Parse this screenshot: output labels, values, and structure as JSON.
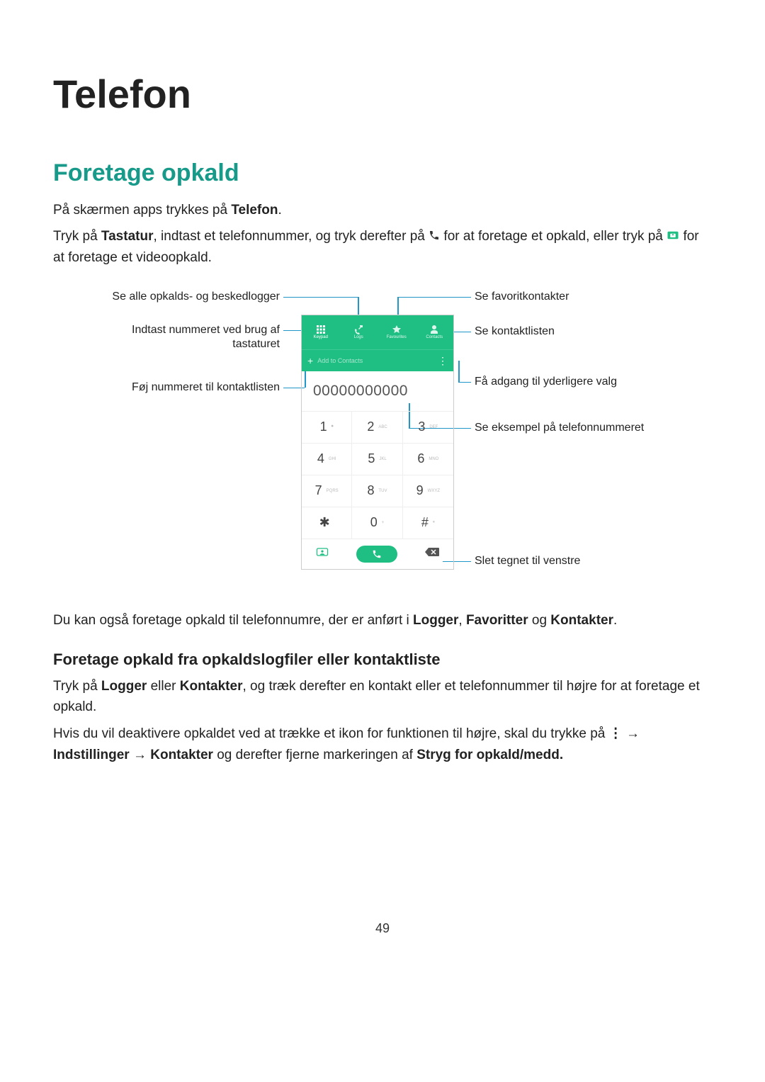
{
  "page_number": "49",
  "title": "Telefon",
  "section_h2": "Foretage opkald",
  "p1_a": "På skærmen apps trykkes på ",
  "p1_b": "Telefon",
  "p1_c": ".",
  "p2_a": "Tryk på ",
  "p2_b": "Tastatur",
  "p2_c": ", indtast et telefonnummer, og tryk derefter på ",
  "p2_d": " for at foretage et opkald, eller tryk på ",
  "p2_e": " for at foretage et videoopkald.",
  "p3_a": "Du kan også foretage opkald til telefonnumre, der er anført i ",
  "p3_b": "Logger",
  "p3_c": ", ",
  "p3_d": "Favoritter",
  "p3_e": " og ",
  "p3_f": "Kontakter",
  "p3_g": ".",
  "h3": "Foretage opkald fra opkaldslogfiler eller kontaktliste",
  "p4_a": "Tryk på ",
  "p4_b": "Logger",
  "p4_c": " eller ",
  "p4_d": "Kontakter",
  "p4_e": ", og træk derefter en kontakt eller et telefonnummer til højre for at foretage et opkald.",
  "p5_a": "Hvis du vil deaktivere opkaldet ved at trække et ikon for funktionen til højre, skal du trykke på ",
  "p5_b": " → ",
  "p5_c": "Indstillinger",
  "p5_d": " → ",
  "p5_e": "Kontakter",
  "p5_f": " og derefter fjerne markeringen af ",
  "p5_g": "Stryg for opkald/medd.",
  "diagram": {
    "labels_left": {
      "logs": "Se alle opkalds- og beskedlogger",
      "keypad_l1": "Indtast nummeret ved brug af",
      "keypad_l2": "tastaturet",
      "add": "Føj nummeret til kontaktlisten"
    },
    "labels_right": {
      "fav": "Se favoritkontakter",
      "contacts": "Se kontaktlisten",
      "more": "Få adgang til yderligere valg",
      "example": "Se eksempel på telefonnummeret",
      "del": "Slet tegnet til venstre"
    },
    "phone": {
      "tabs": [
        "Keypad",
        "Logs",
        "Favourites",
        "Contacts"
      ],
      "add_to_contacts": "Add to Contacts",
      "number": "00000000000",
      "keys": [
        "1",
        "2",
        "3",
        "4",
        "5",
        "6",
        "7",
        "8",
        "9",
        "✱",
        "0",
        "#"
      ],
      "key_subs": [
        "⏺",
        "ABC",
        "DEF",
        "GHI",
        "JKL",
        "MNO",
        "PQRS",
        "TUV",
        "WXYZ",
        "",
        "+",
        "⏸"
      ]
    }
  }
}
